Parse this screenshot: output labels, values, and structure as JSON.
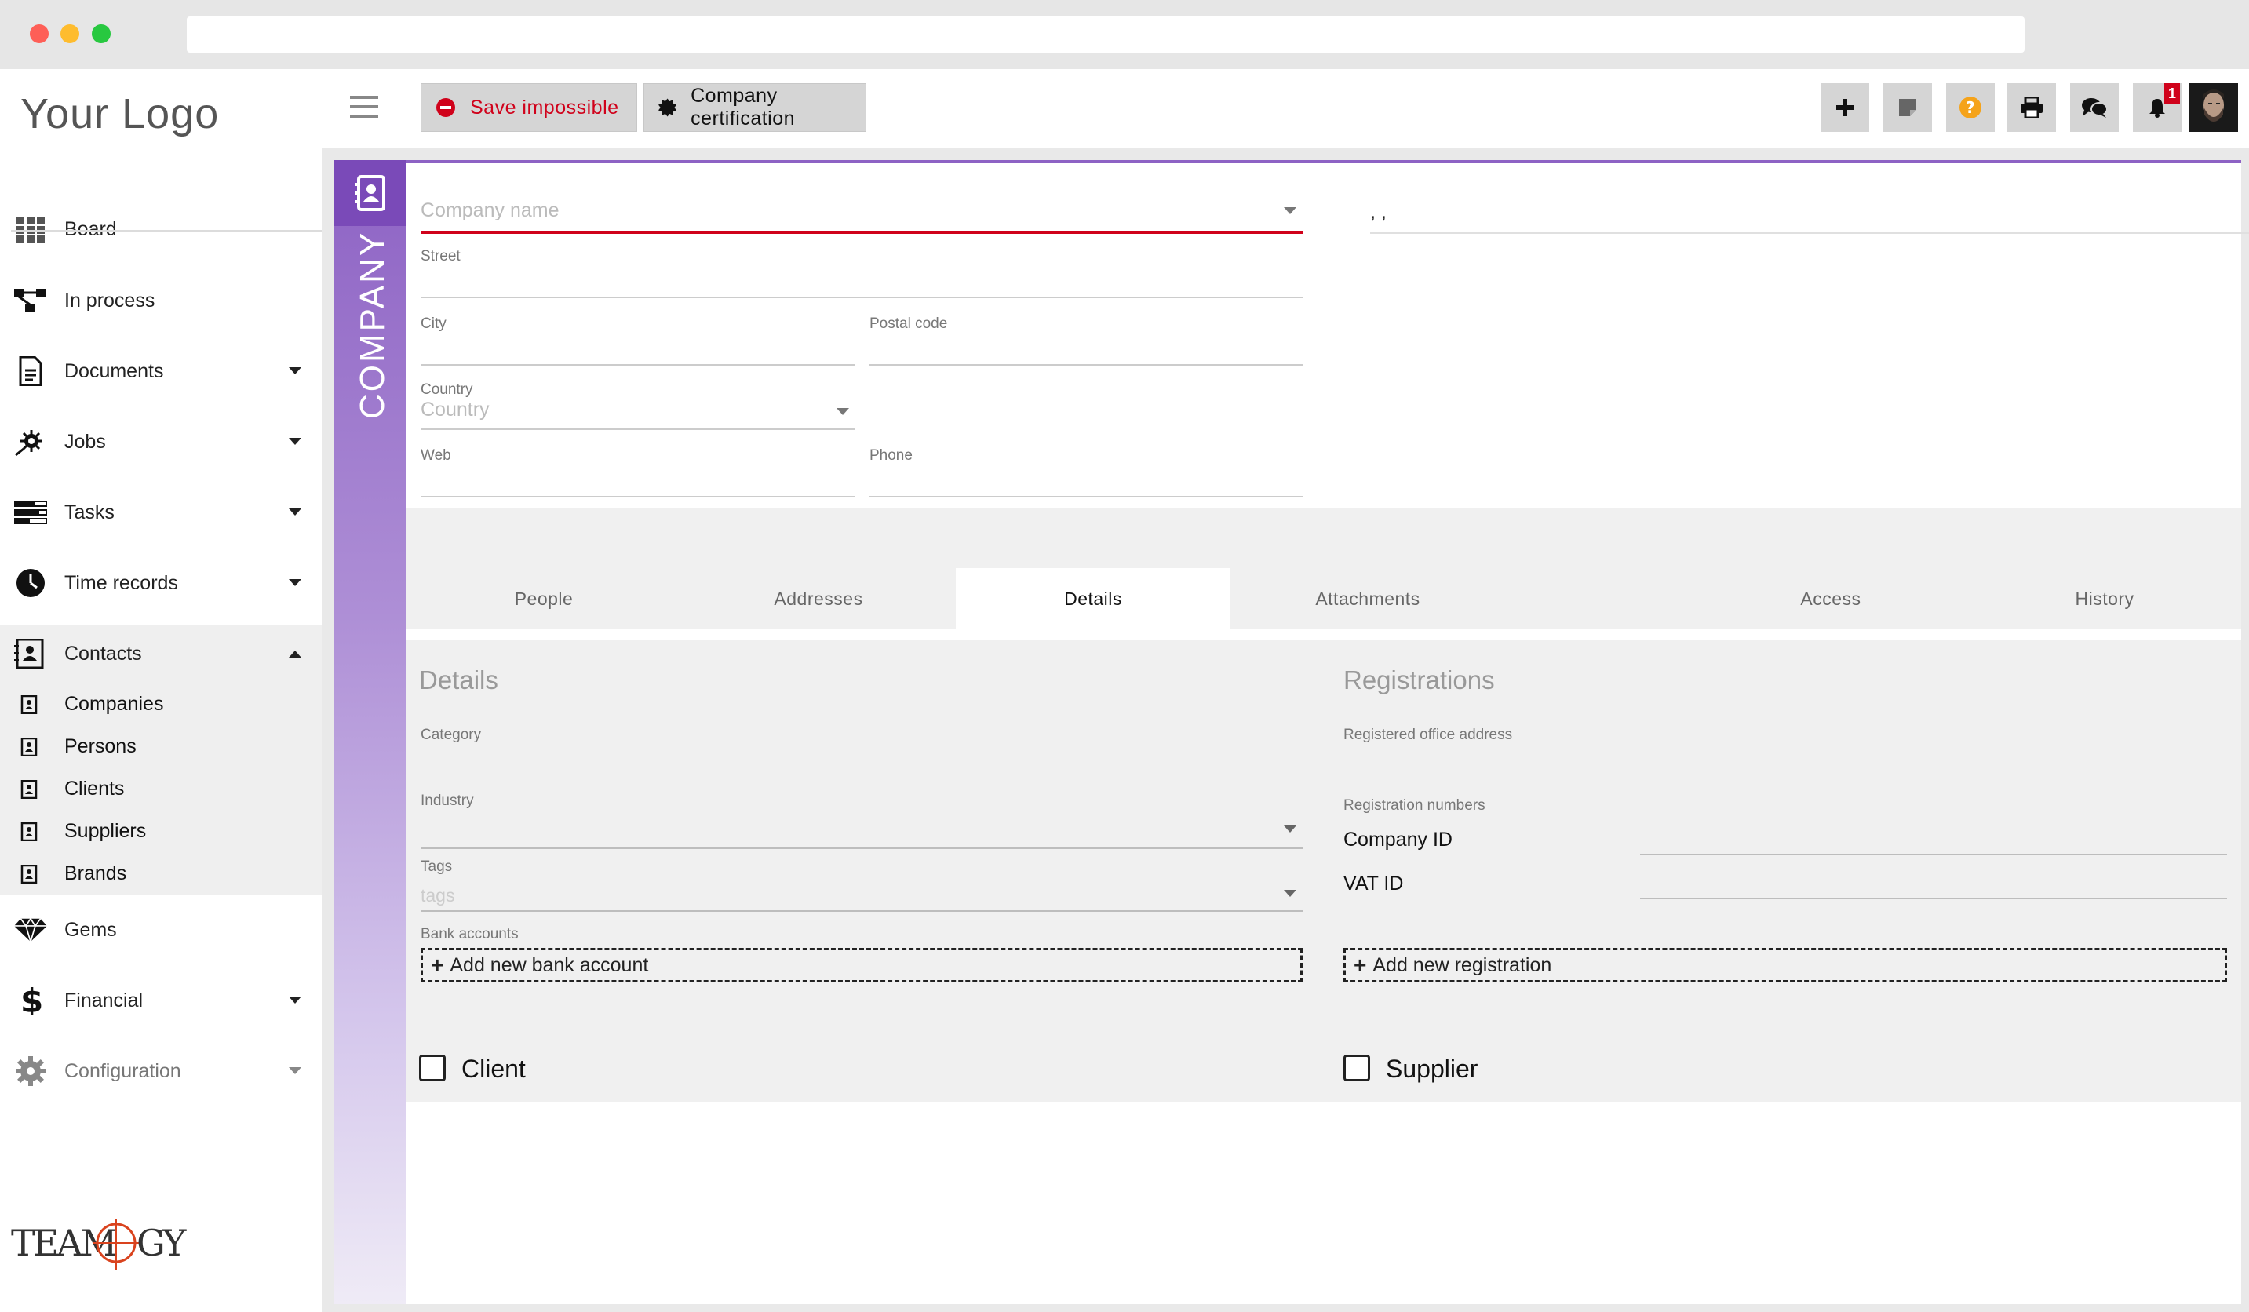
{
  "sidebar": {
    "logo": "Your Logo",
    "nav": [
      {
        "label": "Board",
        "icon": "grid-icon"
      },
      {
        "label": "In process",
        "icon": "workflow-icon"
      },
      {
        "label": "Documents",
        "icon": "document-icon"
      },
      {
        "label": "Jobs",
        "icon": "rocket-icon"
      },
      {
        "label": "Tasks",
        "icon": "tasks-icon"
      },
      {
        "label": "Time records",
        "icon": "clock-icon"
      },
      {
        "label": "Contacts",
        "icon": "contacts-icon"
      }
    ],
    "contacts_sub": [
      {
        "label": "Companies"
      },
      {
        "label": "Persons"
      },
      {
        "label": "Clients"
      },
      {
        "label": "Suppliers"
      },
      {
        "label": "Brands"
      }
    ],
    "nav_bottom": [
      {
        "label": "Gems",
        "icon": "gem-icon"
      },
      {
        "label": "Financial",
        "icon": "dollar-icon"
      },
      {
        "label": "Configuration",
        "icon": "gear-icon"
      }
    ]
  },
  "toolbar": {
    "save_label": "Save impossible",
    "cert_label": "Company certification",
    "notification_count": "1"
  },
  "entity": {
    "label": "COMPANY"
  },
  "form": {
    "company_name_placeholder": "Company name",
    "address_preview": ", ,",
    "street_label": "Street",
    "city_label": "City",
    "postal_label": "Postal code",
    "country_label": "Country",
    "country_placeholder": "Country",
    "web_label": "Web",
    "phone_label": "Phone"
  },
  "tabs": [
    {
      "label": "People"
    },
    {
      "label": "Addresses"
    },
    {
      "label": "Details"
    },
    {
      "label": "Attachments"
    },
    {
      "label": "Access"
    },
    {
      "label": "History"
    }
  ],
  "details": {
    "title": "Details",
    "category_label": "Category",
    "industry_label": "Industry",
    "tags_label": "Tags",
    "tags_placeholder": "tags",
    "bank_label": "Bank accounts",
    "add_bank": "Add new bank account"
  },
  "registrations": {
    "title": "Registrations",
    "office_label": "Registered office address",
    "numbers_label": "Registration numbers",
    "company_id": "Company ID",
    "vat_id": "VAT ID",
    "add_reg": "Add new registration"
  },
  "checks": {
    "client": "Client",
    "supplier": "Supplier"
  }
}
